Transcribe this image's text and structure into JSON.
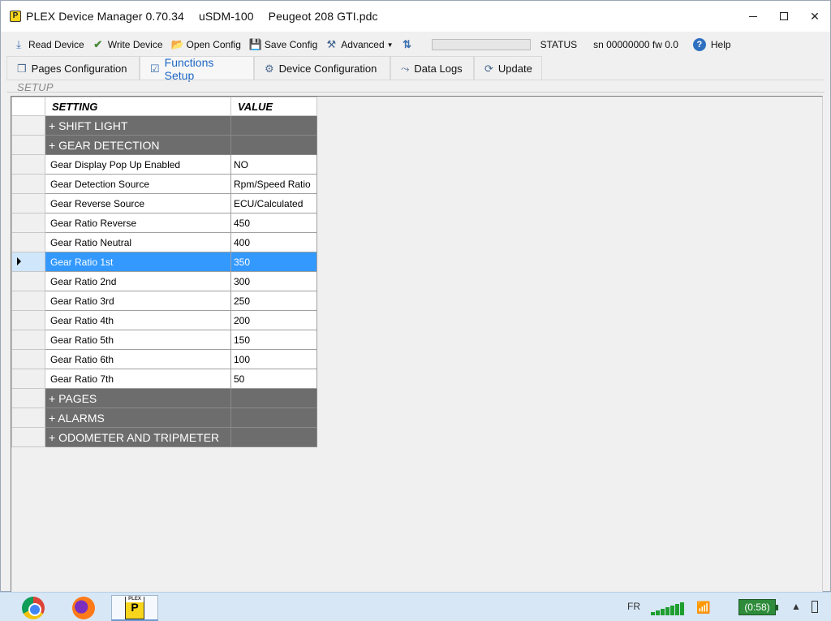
{
  "window": {
    "app_name": "PLEX Device Manager 0.70.34",
    "device": "uSDM-100",
    "file": "Peugeot 208 GTI.pdc",
    "logo": "P",
    "controls": {
      "minimize": "minimize-icon",
      "maximize": "maximize-icon",
      "close": "✕"
    }
  },
  "toolbar": {
    "read_device": "Read Device",
    "write_device": "Write Device",
    "open_config": "Open Config",
    "save_config": "Save Config",
    "advanced": "Advanced",
    "progress": 0,
    "status": "STATUS",
    "serial": "sn 00000000 fw 0.0",
    "help": "Help"
  },
  "tabs": [
    {
      "label": "Pages Configuration",
      "icon": "pages-icon"
    },
    {
      "label": "Functions Setup",
      "icon": "checkbox-icon",
      "active": true
    },
    {
      "label": "Device Configuration",
      "icon": "gears-icon"
    },
    {
      "label": "Data Logs",
      "icon": "chart-icon"
    },
    {
      "label": "Update",
      "icon": "refresh-icon"
    }
  ],
  "section": {
    "label": "SETUP"
  },
  "grid": {
    "columns": [
      "SETTING",
      "VALUE"
    ],
    "rows": [
      {
        "type": "group",
        "setting": "+ SHIFT LIGHT",
        "value": ""
      },
      {
        "type": "group",
        "setting": "+ GEAR DETECTION",
        "value": ""
      },
      {
        "type": "data",
        "setting": "Gear Display Pop Up Enabled",
        "value": "NO"
      },
      {
        "type": "data",
        "setting": "Gear Detection Source",
        "value": "Rpm/Speed Ratio"
      },
      {
        "type": "data",
        "setting": "Gear Reverse Source",
        "value": "ECU/Calculated"
      },
      {
        "type": "data",
        "setting": "Gear Ratio Reverse",
        "value": "450"
      },
      {
        "type": "data",
        "setting": "Gear Ratio Neutral",
        "value": "400"
      },
      {
        "type": "data",
        "setting": "Gear Ratio 1st",
        "value": "350",
        "selected": true
      },
      {
        "type": "data",
        "setting": "Gear Ratio 2nd",
        "value": "300"
      },
      {
        "type": "data",
        "setting": "Gear Ratio 3rd",
        "value": "250"
      },
      {
        "type": "data",
        "setting": "Gear Ratio 4th",
        "value": "200"
      },
      {
        "type": "data",
        "setting": "Gear Ratio 5th",
        "value": "150"
      },
      {
        "type": "data",
        "setting": "Gear Ratio 6th",
        "value": "100"
      },
      {
        "type": "data",
        "setting": "Gear Ratio 7th",
        "value": "50"
      },
      {
        "type": "group",
        "setting": "+ PAGES",
        "value": ""
      },
      {
        "type": "group",
        "setting": "+ ALARMS",
        "value": ""
      },
      {
        "type": "group",
        "setting": "+ ODOMETER AND TRIPMETER",
        "value": ""
      }
    ]
  },
  "taskbar": {
    "apps": [
      "chrome-icon",
      "firefox-icon",
      "plex-icon"
    ],
    "plex_tile_text": "PLEX",
    "plex_tile_letter": "P",
    "language": "FR",
    "battery": "(0:58)"
  },
  "colors": {
    "selection": "#3399ff",
    "group_row": "#6d6d6d",
    "active_tab_text": "#1c66c4"
  }
}
